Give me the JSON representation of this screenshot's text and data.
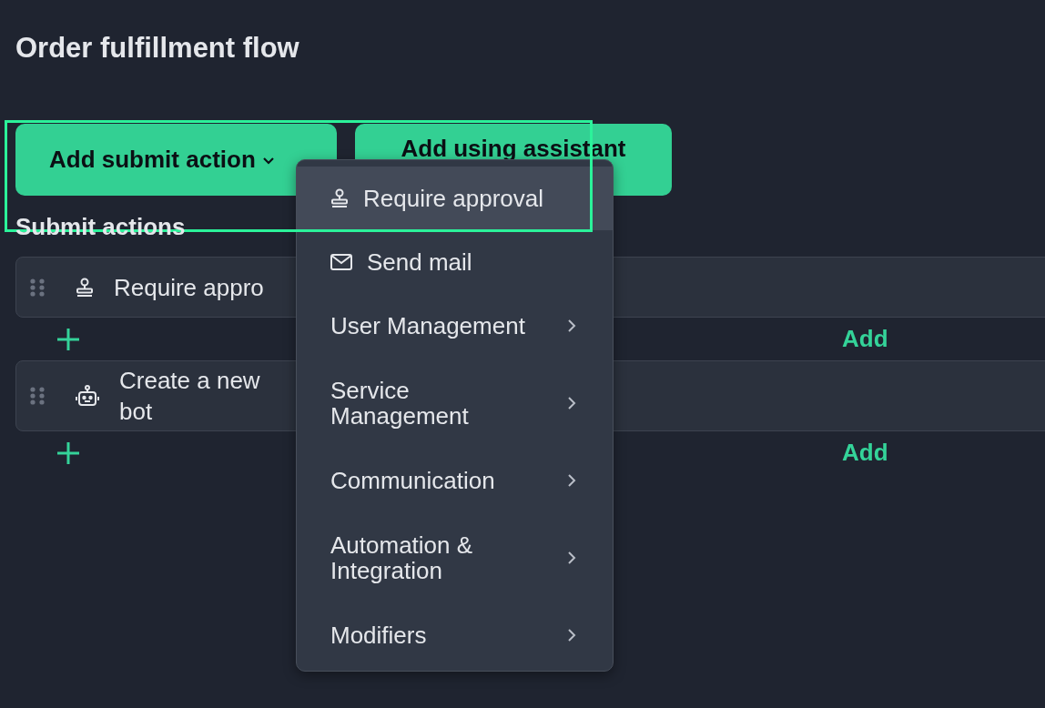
{
  "title": "Order fulfillment flow",
  "buttons": [
    {
      "label": "Add submit action",
      "kind": "dropdown"
    },
    {
      "label": "Add using assistant",
      "kind": "plain"
    }
  ],
  "section_title": "Submit actions",
  "actions": [
    {
      "label": "Require appro",
      "kind": "approval",
      "add_label": "Add"
    },
    {
      "label": "Create a new bot",
      "kind": "bot",
      "add_label": "Add"
    }
  ],
  "menu": {
    "highlight_frame": true,
    "items": [
      {
        "label": "Require approval",
        "kind": "approval",
        "selected": true,
        "submenu": false
      },
      {
        "label": "Send mail",
        "kind": "mail",
        "selected": false,
        "submenu": false
      },
      {
        "label": "User Management",
        "kind": "category",
        "selected": false,
        "submenu": true
      },
      {
        "label": "Service Management",
        "kind": "category",
        "selected": false,
        "submenu": true
      },
      {
        "label": "Communication",
        "kind": "category",
        "selected": false,
        "submenu": true
      },
      {
        "label": "Automation & Integration",
        "kind": "category",
        "selected": false,
        "submenu": true
      },
      {
        "label": "Modifiers",
        "kind": "category",
        "selected": false,
        "submenu": true
      }
    ]
  }
}
